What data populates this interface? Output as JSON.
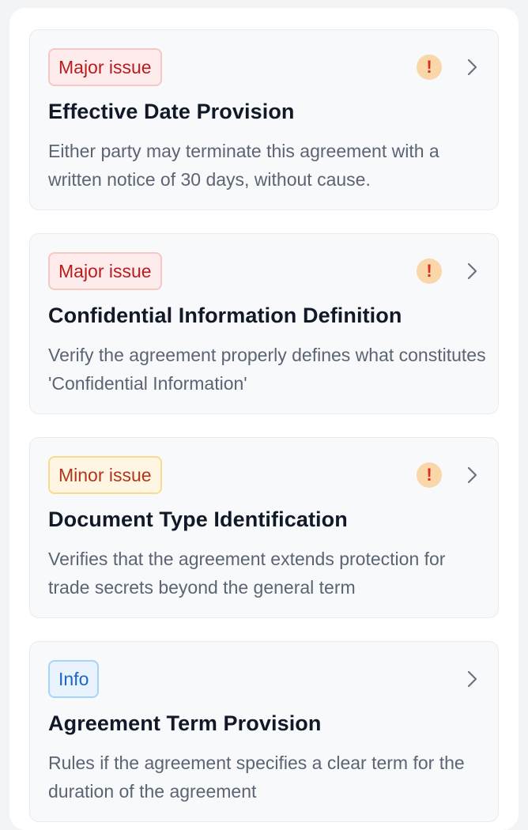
{
  "issues": [
    {
      "badge": "Major issue",
      "severity": "major",
      "has_warning": true,
      "title": "Effective Date Provision",
      "description": "Either party may terminate this agreement with a written notice of 30 days, without cause."
    },
    {
      "badge": "Major issue",
      "severity": "major",
      "has_warning": true,
      "title": "Confidential Information Definition",
      "description": "Verify the agreement properly defines what constitutes 'Confidential Information'"
    },
    {
      "badge": "Minor issue",
      "severity": "minor",
      "has_warning": true,
      "title": "Document Type Identification",
      "description": "Verifies that the agreement extends protection for trade secrets beyond the general term"
    },
    {
      "badge": "Info",
      "severity": "info",
      "has_warning": false,
      "title": "Agreement Term Provision",
      "description": "Rules if the agreement specifies a clear term for the duration of the agreement"
    }
  ],
  "icons": {
    "warning": "exclamation-icon",
    "chevron": "chevron-right-icon",
    "warning_glyph": "!"
  },
  "colors": {
    "major_text": "#b91c1c",
    "minor_text": "#b4331d",
    "info_text": "#1d64c8",
    "warning_bg": "#fad7a8",
    "warning_fg": "#d92d20"
  }
}
